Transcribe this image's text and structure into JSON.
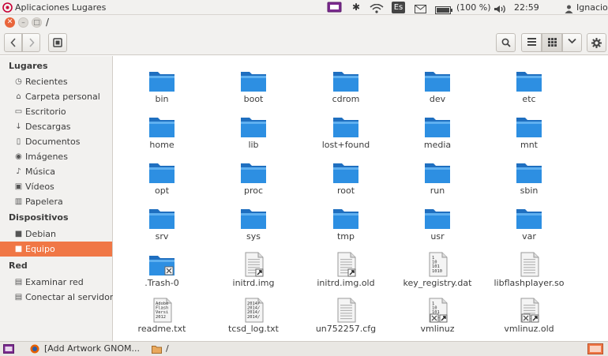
{
  "topbar": {
    "menu_apps": "Aplicaciones",
    "menu_places": "Lugares",
    "keyboard_layout": "Es",
    "battery": "(100 %)",
    "clock": "22:59",
    "user": "Ignacio"
  },
  "window": {
    "title": "/"
  },
  "sidebar": {
    "sections": [
      {
        "heading": "Lugares",
        "items": [
          {
            "label": "Recientes",
            "icon": "clock-icon"
          },
          {
            "label": "Carpeta personal",
            "icon": "home-icon"
          },
          {
            "label": "Escritorio",
            "icon": "desktop-icon"
          },
          {
            "label": "Descargas",
            "icon": "download-icon"
          },
          {
            "label": "Documentos",
            "icon": "document-icon"
          },
          {
            "label": "Imágenes",
            "icon": "camera-icon"
          },
          {
            "label": "Música",
            "icon": "music-icon"
          },
          {
            "label": "Vídeos",
            "icon": "video-icon"
          },
          {
            "label": "Papelera",
            "icon": "trash-icon"
          }
        ]
      },
      {
        "heading": "Dispositivos",
        "items": [
          {
            "label": "Debian",
            "icon": "drive-icon"
          },
          {
            "label": "Equipo",
            "icon": "computer-icon",
            "selected": true
          }
        ]
      },
      {
        "heading": "Red",
        "items": [
          {
            "label": "Examinar red",
            "icon": "network-icon"
          },
          {
            "label": "Conectar al servidor",
            "icon": "server-icon"
          }
        ]
      }
    ]
  },
  "files": [
    {
      "name": "bin",
      "type": "folder"
    },
    {
      "name": "boot",
      "type": "folder"
    },
    {
      "name": "cdrom",
      "type": "folder"
    },
    {
      "name": "dev",
      "type": "folder"
    },
    {
      "name": "etc",
      "type": "folder"
    },
    {
      "name": "home",
      "type": "folder"
    },
    {
      "name": "lib",
      "type": "folder"
    },
    {
      "name": "lost+found",
      "type": "folder"
    },
    {
      "name": "media",
      "type": "folder"
    },
    {
      "name": "mnt",
      "type": "folder"
    },
    {
      "name": "opt",
      "type": "folder"
    },
    {
      "name": "proc",
      "type": "folder"
    },
    {
      "name": "root",
      "type": "folder"
    },
    {
      "name": "run",
      "type": "folder"
    },
    {
      "name": "sbin",
      "type": "folder"
    },
    {
      "name": "srv",
      "type": "folder"
    },
    {
      "name": "sys",
      "type": "folder"
    },
    {
      "name": "tmp",
      "type": "folder"
    },
    {
      "name": "usr",
      "type": "folder"
    },
    {
      "name": "var",
      "type": "folder"
    },
    {
      "name": ".Trash-0",
      "type": "folder-locked"
    },
    {
      "name": "initrd.img",
      "type": "link"
    },
    {
      "name": "initrd.img.old",
      "type": "link"
    },
    {
      "name": "key_registry.dat",
      "type": "binary"
    },
    {
      "name": "libflashplayer.so",
      "type": "text"
    },
    {
      "name": "readme.txt",
      "type": "preview",
      "preview": [
        "Adobe",
        "Flash",
        "Versi",
        "2012"
      ]
    },
    {
      "name": "tcsd_log.txt",
      "type": "preview",
      "preview": [
        "2014/",
        "2014/",
        "2014/",
        "2014/"
      ]
    },
    {
      "name": "un752257.cfg",
      "type": "text"
    },
    {
      "name": "vmlinuz",
      "type": "binary-link-locked"
    },
    {
      "name": "vmlinuz.old",
      "type": "text-link-locked"
    }
  ],
  "binary_preview": [
    "1",
    "10",
    "101",
    "1010"
  ],
  "taskbar": {
    "task1": "[Add  Artwork GNOM...",
    "task2": "/"
  },
  "colors": {
    "accent": "#f07746",
    "folder_blue": "#2d8fe2"
  }
}
